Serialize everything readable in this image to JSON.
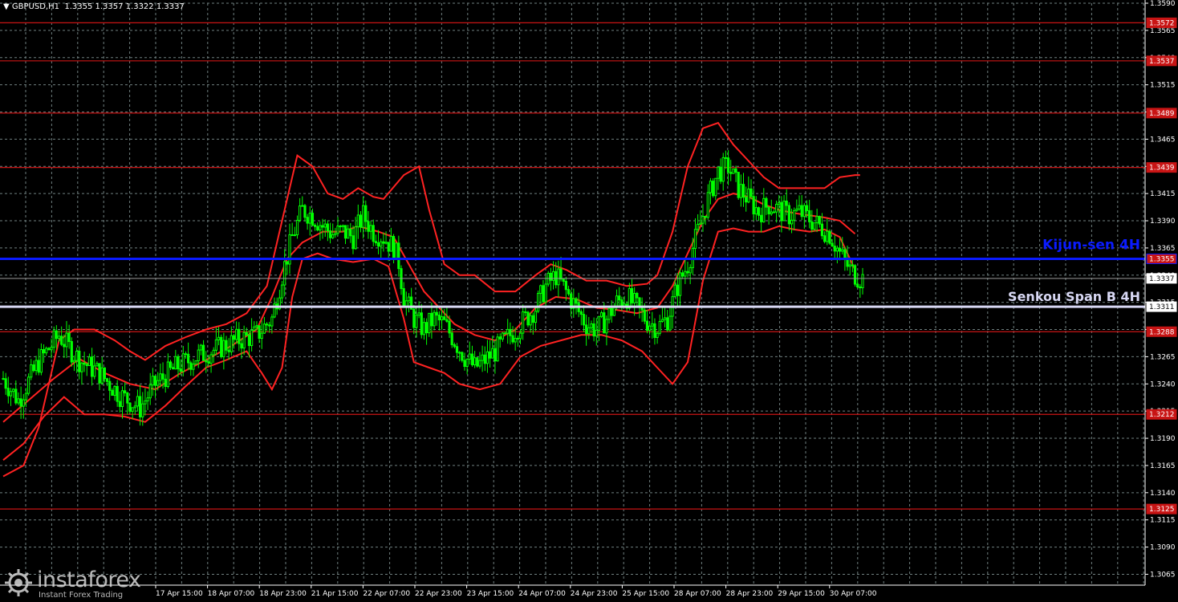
{
  "header": {
    "arrow": "▼",
    "symbol": "GBPUSD,H1",
    "ohlc": "1.3355 1.3357 1.3322 1.3337"
  },
  "watermark": {
    "name": "instaforex",
    "tagline": "Instant Forex Trading"
  },
  "colors": {
    "background": "#000000",
    "grid": "#6f7f7f",
    "candle": "#00ff00",
    "bands": "#ff2222",
    "levels": "#c81414",
    "kijun": "#0a1bff",
    "senkou": "#d8d8f4",
    "axis_text": "#ffffff"
  },
  "chart_data": {
    "type": "candlestick",
    "symbol": "GBPUSD",
    "timeframe": "H1",
    "ylim": [
      1.3055,
      1.359
    ],
    "y_ticks": [
      "1.3590",
      "1.3565",
      "1.3540",
      "1.3515",
      "1.3490",
      "1.3465",
      "1.3440",
      "1.3415",
      "1.3390",
      "1.3365",
      "1.3340",
      "1.3315",
      "1.3290",
      "1.3265",
      "1.3240",
      "1.3215",
      "1.3190",
      "1.3165",
      "1.3140",
      "1.3115",
      "1.3090",
      "1.3065"
    ],
    "x_ticks": [
      "17 Apr 15:00",
      "18 Apr 07:00",
      "18 Apr 23:00",
      "21 Apr 15:00",
      "22 Apr 07:00",
      "22 Apr 23:00",
      "23 Apr 15:00",
      "24 Apr 07:00",
      "24 Apr 23:00",
      "25 Apr 15:00",
      "28 Apr 07:00",
      "28 Apr 23:00",
      "29 Apr 15:00",
      "30 Apr 07:00"
    ],
    "levels": [
      {
        "value": 1.3572,
        "label": "1.3572"
      },
      {
        "value": 1.3537,
        "label": "1.3537"
      },
      {
        "value": 1.3489,
        "label": "1.3489"
      },
      {
        "value": 1.3439,
        "label": "1.3439"
      },
      {
        "value": 1.3288,
        "label": "1.3288"
      },
      {
        "value": 1.3212,
        "label": "1.3212"
      },
      {
        "value": 1.3125,
        "label": "1.3125"
      }
    ],
    "kijun": {
      "value": 1.3355,
      "label": "1.3355",
      "caption": "Kijun-sen 4H"
    },
    "senkou": {
      "value": 1.3311,
      "label": "1.3311",
      "caption": "Senkou Span B 4H"
    },
    "current_price": {
      "value": 1.3337,
      "label": "1.3337"
    },
    "close_path": [
      [
        0,
        1.3245
      ],
      [
        6,
        1.3225
      ],
      [
        14,
        1.326
      ],
      [
        22,
        1.3285
      ],
      [
        30,
        1.3262
      ],
      [
        38,
        1.325
      ],
      [
        46,
        1.323
      ],
      [
        54,
        1.3218
      ],
      [
        60,
        1.324
      ],
      [
        68,
        1.3255
      ],
      [
        76,
        1.3265
      ],
      [
        84,
        1.3272
      ],
      [
        92,
        1.328
      ],
      [
        100,
        1.3285
      ],
      [
        106,
        1.33
      ],
      [
        110,
        1.334
      ],
      [
        114,
        1.3375
      ],
      [
        118,
        1.34
      ],
      [
        122,
        1.3395
      ],
      [
        126,
        1.3385
      ],
      [
        130,
        1.3378
      ],
      [
        134,
        1.338
      ],
      [
        138,
        1.3375
      ],
      [
        142,
        1.3395
      ],
      [
        146,
        1.338
      ],
      [
        150,
        1.3375
      ],
      [
        154,
        1.3365
      ],
      [
        156,
        1.3352
      ],
      [
        158,
        1.332
      ],
      [
        162,
        1.33
      ],
      [
        166,
        1.329
      ],
      [
        170,
        1.33
      ],
      [
        174,
        1.3295
      ],
      [
        178,
        1.328
      ],
      [
        182,
        1.3265
      ],
      [
        186,
        1.3255
      ],
      [
        190,
        1.3262
      ],
      [
        194,
        1.327
      ],
      [
        198,
        1.328
      ],
      [
        202,
        1.329
      ],
      [
        206,
        1.33
      ],
      [
        210,
        1.331
      ],
      [
        214,
        1.333
      ],
      [
        218,
        1.334
      ],
      [
        222,
        1.3325
      ],
      [
        226,
        1.331
      ],
      [
        230,
        1.3295
      ],
      [
        234,
        1.329
      ],
      [
        238,
        1.33
      ],
      [
        242,
        1.3315
      ],
      [
        246,
        1.332
      ],
      [
        250,
        1.331
      ],
      [
        254,
        1.3298
      ],
      [
        258,
        1.3292
      ],
      [
        262,
        1.33
      ],
      [
        266,
        1.333
      ],
      [
        270,
        1.335
      ],
      [
        274,
        1.338
      ],
      [
        278,
        1.341
      ],
      [
        282,
        1.3435
      ],
      [
        286,
        1.344
      ],
      [
        290,
        1.342
      ],
      [
        294,
        1.341
      ],
      [
        298,
        1.3398
      ],
      [
        302,
        1.3405
      ],
      [
        306,
        1.34
      ],
      [
        310,
        1.3395
      ],
      [
        314,
        1.3398
      ],
      [
        318,
        1.3392
      ],
      [
        322,
        1.3385
      ],
      [
        326,
        1.3378
      ],
      [
        330,
        1.336
      ],
      [
        334,
        1.3345
      ],
      [
        338,
        1.3337
      ]
    ],
    "n_bars": 340,
    "series": [
      {
        "name": "upper",
        "points": [
          [
            0,
            1.3155
          ],
          [
            8,
            1.3165
          ],
          [
            14,
            1.32
          ],
          [
            22,
            1.328
          ],
          [
            28,
            1.329
          ],
          [
            36,
            1.329
          ],
          [
            44,
            1.328
          ],
          [
            50,
            1.327
          ],
          [
            56,
            1.3262
          ],
          [
            64,
            1.3275
          ],
          [
            72,
            1.3283
          ],
          [
            80,
            1.329
          ],
          [
            88,
            1.3295
          ],
          [
            96,
            1.3305
          ],
          [
            104,
            1.333
          ],
          [
            110,
            1.339
          ],
          [
            116,
            1.345
          ],
          [
            122,
            1.344
          ],
          [
            128,
            1.3415
          ],
          [
            134,
            1.341
          ],
          [
            140,
            1.342
          ],
          [
            146,
            1.3412
          ],
          [
            150,
            1.341
          ],
          [
            158,
            1.3432
          ],
          [
            164,
            1.344
          ],
          [
            168,
            1.34
          ],
          [
            174,
            1.335
          ],
          [
            180,
            1.334
          ],
          [
            186,
            1.334
          ],
          [
            194,
            1.3325
          ],
          [
            202,
            1.3325
          ],
          [
            210,
            1.334
          ],
          [
            216,
            1.335
          ],
          [
            222,
            1.3345
          ],
          [
            230,
            1.3335
          ],
          [
            238,
            1.3335
          ],
          [
            246,
            1.333
          ],
          [
            254,
            1.3332
          ],
          [
            258,
            1.334
          ],
          [
            264,
            1.338
          ],
          [
            270,
            1.344
          ],
          [
            276,
            1.3475
          ],
          [
            282,
            1.348
          ],
          [
            288,
            1.346
          ],
          [
            294,
            1.3445
          ],
          [
            300,
            1.343
          ],
          [
            306,
            1.342
          ],
          [
            312,
            1.342
          ],
          [
            318,
            1.342
          ],
          [
            324,
            1.342
          ],
          [
            330,
            1.343
          ],
          [
            336,
            1.3432
          ],
          [
            338,
            1.3432
          ]
        ]
      },
      {
        "name": "middle",
        "points": [
          [
            0,
            1.3205
          ],
          [
            10,
            1.3225
          ],
          [
            20,
            1.3245
          ],
          [
            30,
            1.3263
          ],
          [
            40,
            1.325
          ],
          [
            50,
            1.324
          ],
          [
            60,
            1.3235
          ],
          [
            70,
            1.325
          ],
          [
            80,
            1.3262
          ],
          [
            90,
            1.3275
          ],
          [
            100,
            1.329
          ],
          [
            106,
            1.332
          ],
          [
            112,
            1.3355
          ],
          [
            118,
            1.337
          ],
          [
            126,
            1.338
          ],
          [
            134,
            1.338
          ],
          [
            140,
            1.3385
          ],
          [
            148,
            1.338
          ],
          [
            154,
            1.3375
          ],
          [
            160,
            1.335
          ],
          [
            166,
            1.3325
          ],
          [
            172,
            1.331
          ],
          [
            178,
            1.3295
          ],
          [
            186,
            1.3285
          ],
          [
            194,
            1.328
          ],
          [
            202,
            1.329
          ],
          [
            210,
            1.331
          ],
          [
            218,
            1.332
          ],
          [
            226,
            1.3318
          ],
          [
            234,
            1.331
          ],
          [
            242,
            1.3308
          ],
          [
            250,
            1.3305
          ],
          [
            258,
            1.331
          ],
          [
            264,
            1.333
          ],
          [
            270,
            1.336
          ],
          [
            276,
            1.339
          ],
          [
            282,
            1.341
          ],
          [
            288,
            1.3415
          ],
          [
            294,
            1.3412
          ],
          [
            300,
            1.3405
          ],
          [
            306,
            1.34
          ],
          [
            312,
            1.3397
          ],
          [
            318,
            1.3395
          ],
          [
            324,
            1.3393
          ],
          [
            330,
            1.339
          ],
          [
            336,
            1.3378
          ]
        ]
      },
      {
        "name": "lower",
        "points": [
          [
            0,
            1.317
          ],
          [
            8,
            1.3185
          ],
          [
            16,
            1.321
          ],
          [
            24,
            1.3228
          ],
          [
            32,
            1.3212
          ],
          [
            40,
            1.3212
          ],
          [
            48,
            1.321
          ],
          [
            56,
            1.3205
          ],
          [
            64,
            1.322
          ],
          [
            72,
            1.3238
          ],
          [
            80,
            1.3255
          ],
          [
            88,
            1.3262
          ],
          [
            96,
            1.327
          ],
          [
            102,
            1.325
          ],
          [
            106,
            1.3235
          ],
          [
            110,
            1.3255
          ],
          [
            114,
            1.332
          ],
          [
            118,
            1.3355
          ],
          [
            124,
            1.336
          ],
          [
            130,
            1.3355
          ],
          [
            138,
            1.3352
          ],
          [
            146,
            1.3355
          ],
          [
            152,
            1.3348
          ],
          [
            158,
            1.33
          ],
          [
            162,
            1.326
          ],
          [
            168,
            1.3255
          ],
          [
            174,
            1.325
          ],
          [
            180,
            1.324
          ],
          [
            188,
            1.3235
          ],
          [
            196,
            1.324
          ],
          [
            204,
            1.3265
          ],
          [
            212,
            1.3275
          ],
          [
            220,
            1.328
          ],
          [
            228,
            1.3285
          ],
          [
            236,
            1.3285
          ],
          [
            244,
            1.328
          ],
          [
            252,
            1.327
          ],
          [
            258,
            1.3255
          ],
          [
            264,
            1.324
          ],
          [
            270,
            1.326
          ],
          [
            276,
            1.3335
          ],
          [
            282,
            1.338
          ],
          [
            288,
            1.3383
          ],
          [
            294,
            1.338
          ],
          [
            300,
            1.338
          ],
          [
            306,
            1.3385
          ],
          [
            312,
            1.3382
          ],
          [
            318,
            1.338
          ],
          [
            324,
            1.3382
          ],
          [
            330,
            1.3375
          ],
          [
            336,
            1.3345
          ]
        ]
      }
    ]
  }
}
